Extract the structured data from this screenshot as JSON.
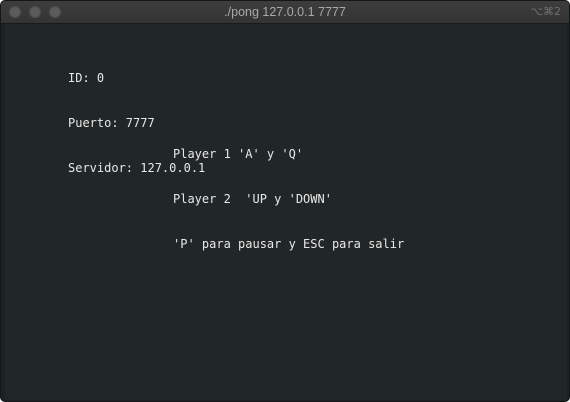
{
  "window": {
    "title": "./pong 127.0.0.1 7777",
    "shortcut": "⌥⌘2"
  },
  "terminal": {
    "info_lines": [
      "ID: 0",
      "Puerto: 7777",
      "Servidor: 127.0.0.1"
    ],
    "help_lines": [
      "Player 1 'A' y 'Q'",
      "Player 2  'UP y 'DOWN'",
      "'P' para pausar y ESC para salir"
    ]
  },
  "colors": {
    "terminal_background": "#212627",
    "text": "#e8e8e8",
    "titlebar": "#383838"
  }
}
